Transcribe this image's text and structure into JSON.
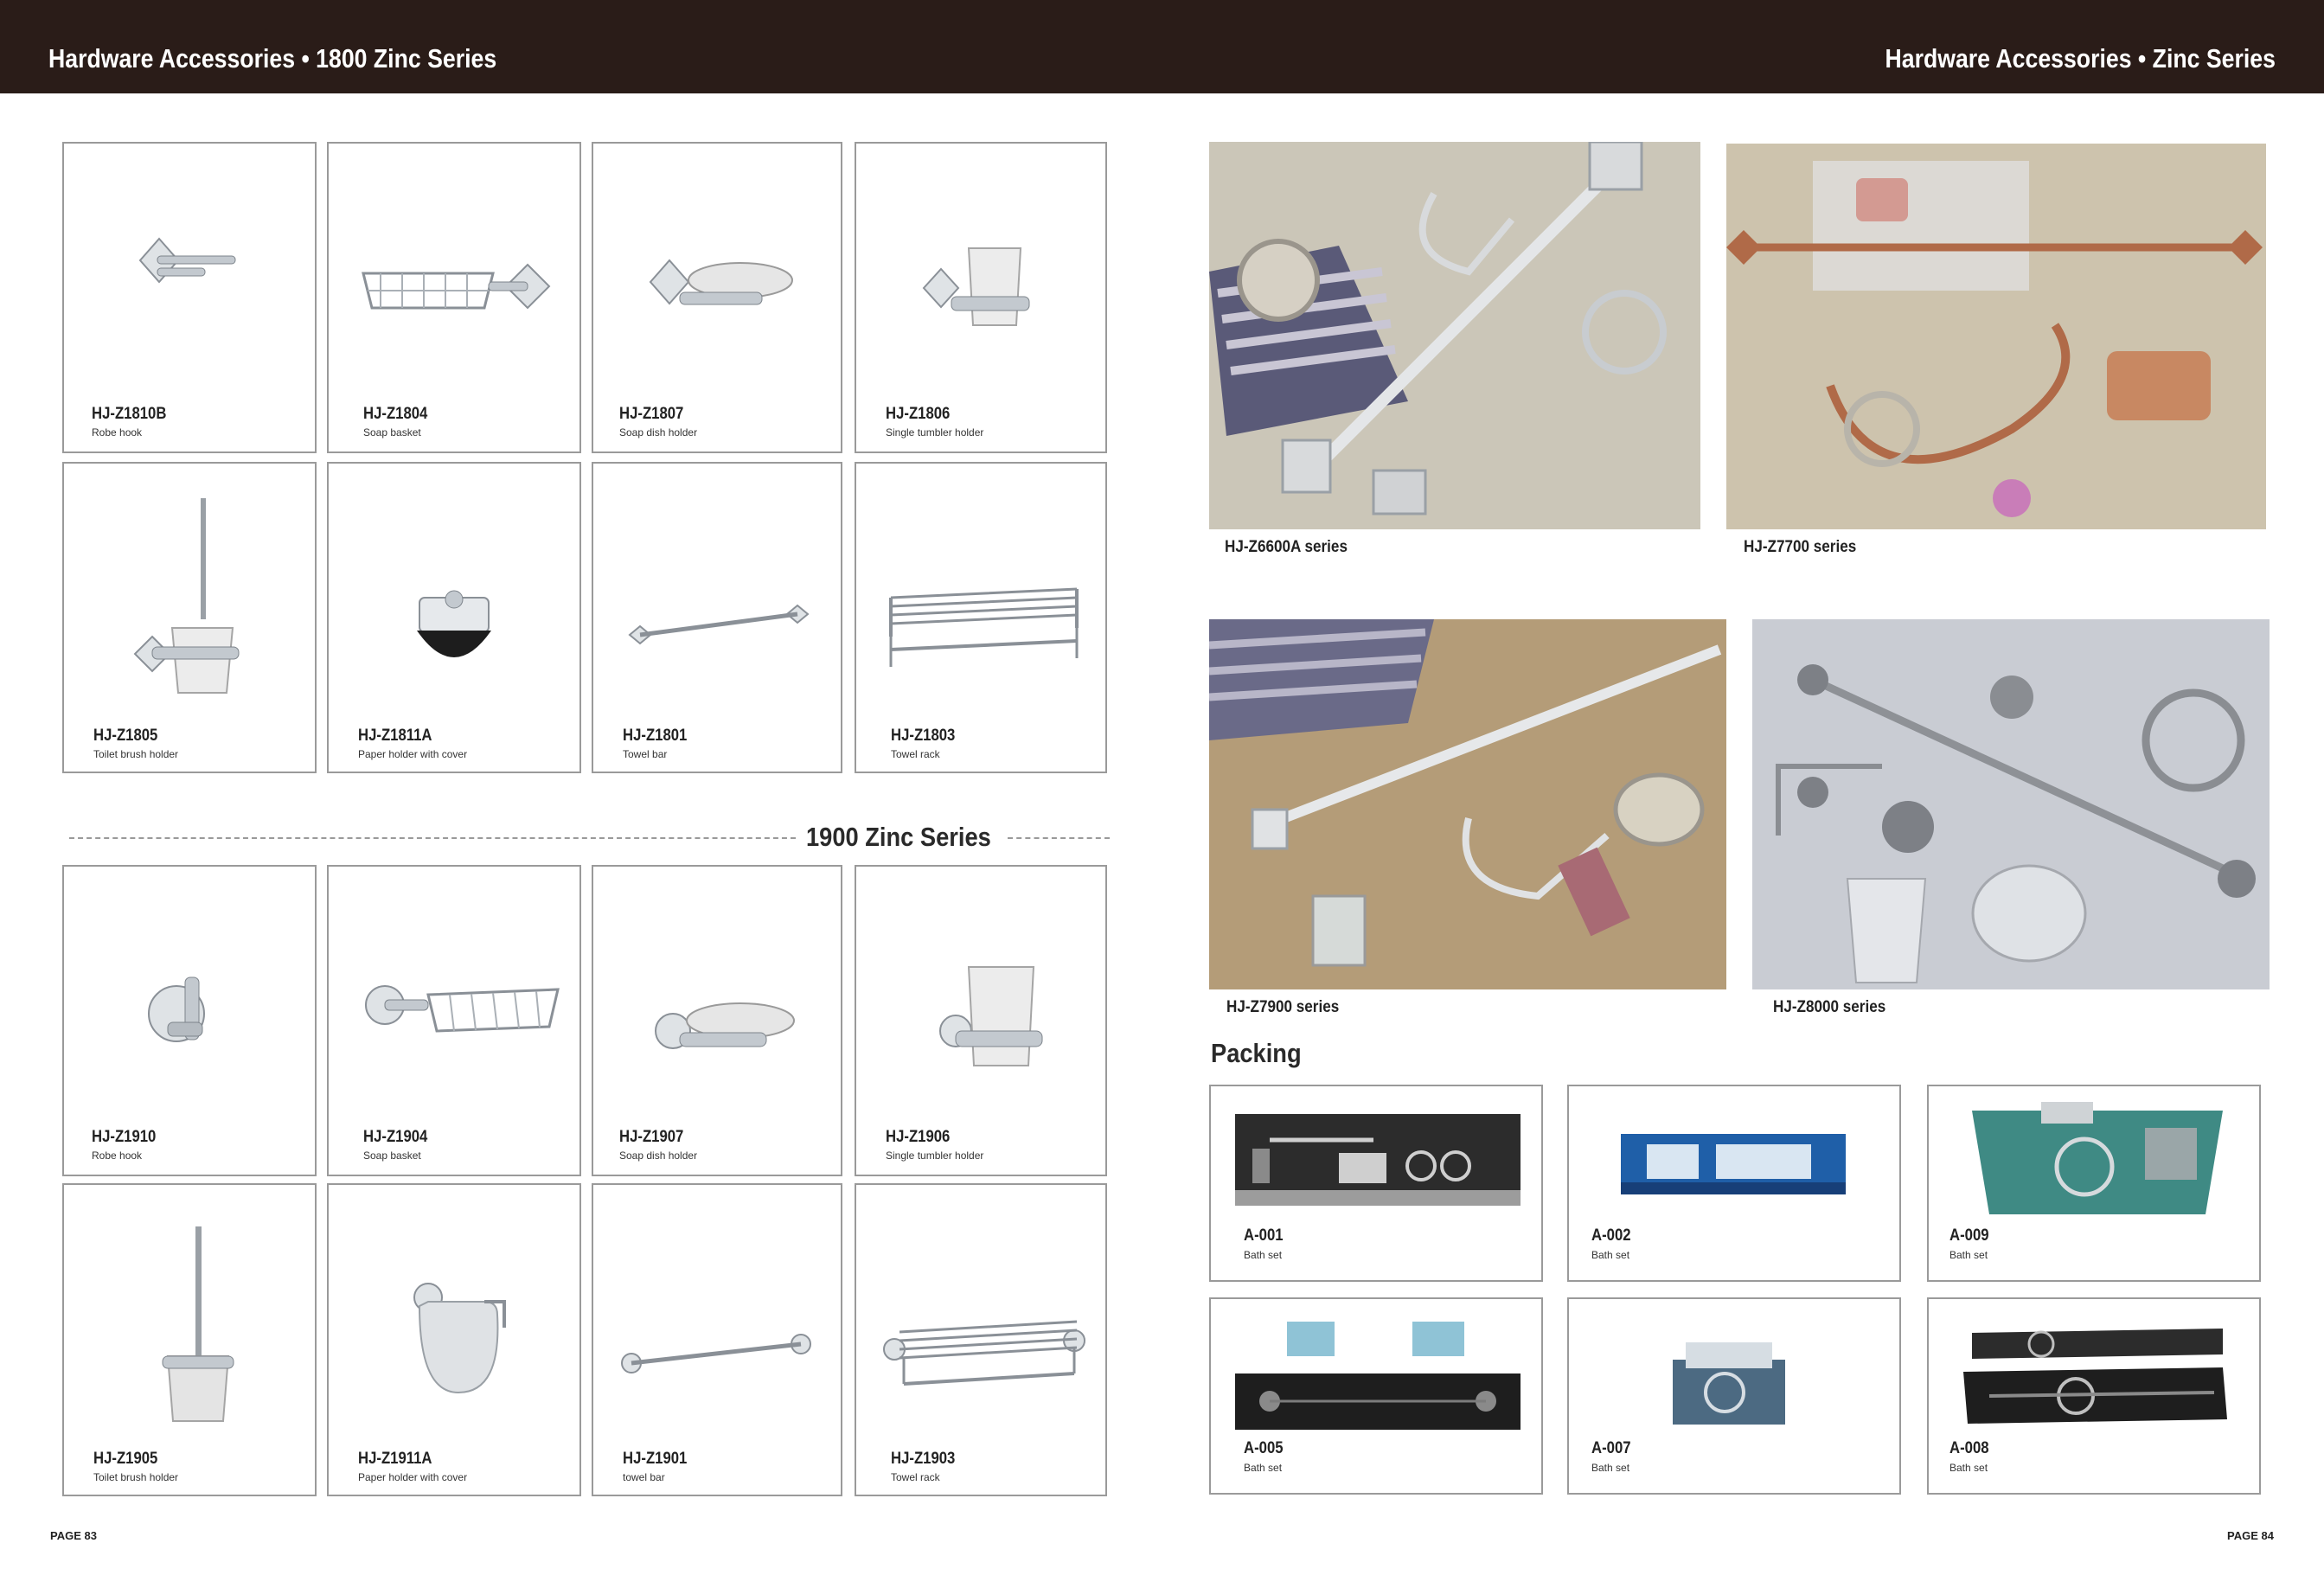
{
  "header": {
    "left_title": "Hardware Accessories • 1800 Zinc  Series",
    "right_title": "Hardware Accessories • Zinc Series"
  },
  "series_1800": [
    {
      "code": "HJ-Z1810B",
      "desc": "Robe hook",
      "icon": "robe-hook-icon"
    },
    {
      "code": "HJ-Z1804",
      "desc": "Soap basket",
      "icon": "soap-basket-icon"
    },
    {
      "code": "HJ-Z1807",
      "desc": "Soap dish holder",
      "icon": "soap-dish-icon"
    },
    {
      "code": "HJ-Z1806",
      "desc": "Single tumbler holder",
      "icon": "tumbler-holder-icon"
    },
    {
      "code": "HJ-Z1805",
      "desc": "Toilet brush holder",
      "icon": "toilet-brush-icon"
    },
    {
      "code": "HJ-Z1811A",
      "desc": "Paper holder with cover",
      "icon": "paper-holder-icon"
    },
    {
      "code": "HJ-Z1801",
      "desc": "Towel bar",
      "icon": "towel-bar-icon"
    },
    {
      "code": "HJ-Z1803",
      "desc": "Towel rack",
      "icon": "towel-rack-icon"
    }
  ],
  "series_1900_title": "1900 Zinc Series",
  "series_1900": [
    {
      "code": "HJ-Z1910",
      "desc": "Robe hook",
      "icon": "robe-hook-icon"
    },
    {
      "code": "HJ-Z1904",
      "desc": "Soap basket",
      "icon": "soap-basket-icon"
    },
    {
      "code": "HJ-Z1907",
      "desc": "Soap dish holder",
      "icon": "soap-dish-icon"
    },
    {
      "code": "HJ-Z1906",
      "desc": "Single tumbler holder",
      "icon": "tumbler-holder-icon"
    },
    {
      "code": "HJ-Z1905",
      "desc": "Toilet brush holder",
      "icon": "toilet-brush-icon"
    },
    {
      "code": "HJ-Z1911A",
      "desc": "Paper holder with cover",
      "icon": "paper-holder-icon"
    },
    {
      "code": "HJ-Z1901",
      "desc": "towel bar",
      "icon": "towel-bar-icon"
    },
    {
      "code": "HJ-Z1903",
      "desc": "Towel rack",
      "icon": "towel-rack-icon"
    }
  ],
  "series_photos": [
    {
      "caption": "HJ-Z6600A  series"
    },
    {
      "caption": "HJ-Z7700 series"
    },
    {
      "caption": "HJ-Z7900  series"
    },
    {
      "caption": "HJ-Z8000  series"
    }
  ],
  "packing_title": "Packing",
  "packing": [
    {
      "code": "A-001",
      "desc": "Bath set"
    },
    {
      "code": "A-002",
      "desc": "Bath set"
    },
    {
      "code": "A-009",
      "desc": "Bath set"
    },
    {
      "code": "A-005",
      "desc": "Bath set"
    },
    {
      "code": "A-007",
      "desc": "Bath set"
    },
    {
      "code": "A-008",
      "desc": "Bath set"
    }
  ],
  "colors": {
    "header_bg": "#2a1c18",
    "chrome": "#c9ced3",
    "frame": "#9a9a9a"
  },
  "page_numbers": {
    "left": "PAGE 83",
    "right": "PAGE 84"
  }
}
